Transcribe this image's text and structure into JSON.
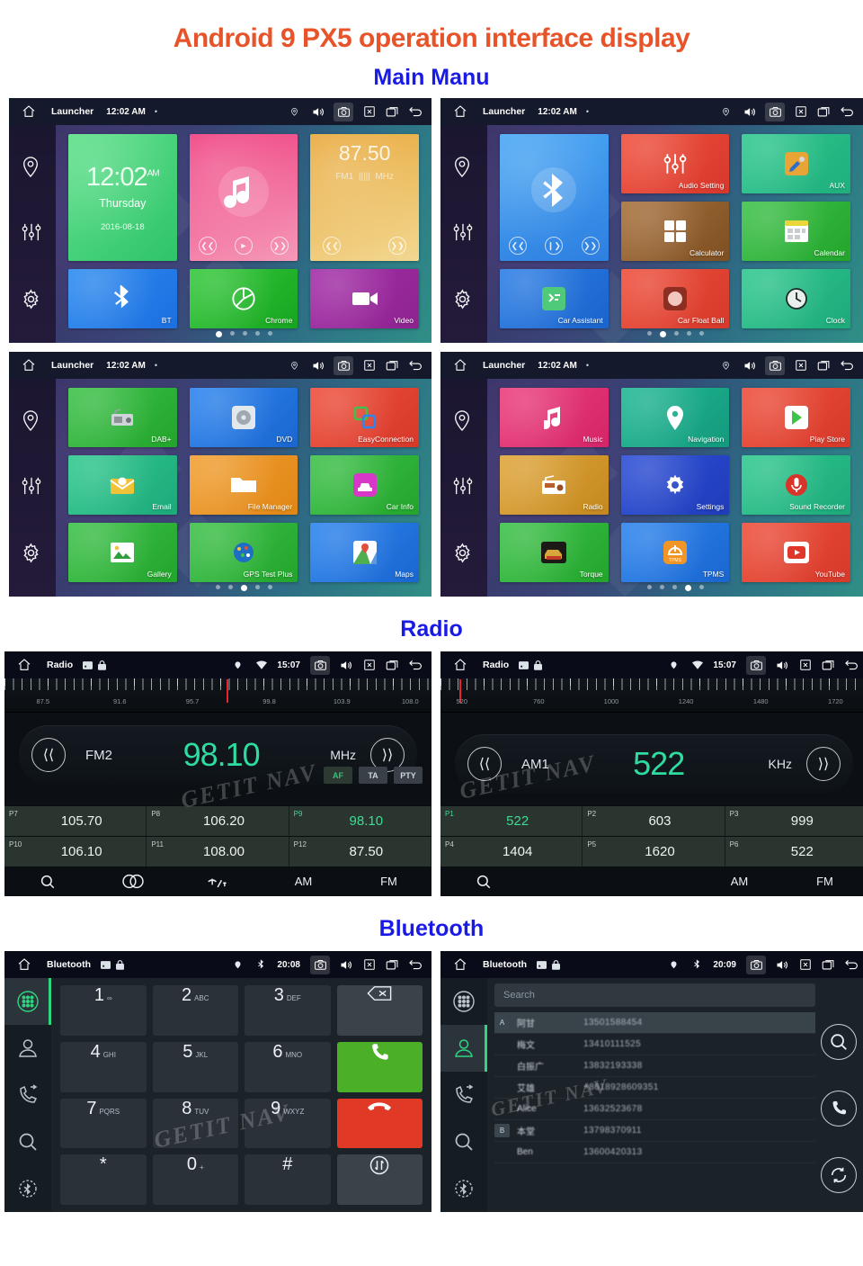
{
  "page": {
    "main_title_prefix": "Android",
    "main_title_number": "9",
    "main_title_suffix": "PX5 operation interface display",
    "section_main_menu": "Main Manu",
    "section_radio": "Radio",
    "section_bluetooth": "Bluetooth",
    "watermark": "GETIT NAV",
    "colors": {
      "title_orange": "#e8542a",
      "section_blue": "#1a1ae6",
      "radio_green": "#2fdca0",
      "accent_green": "#2fd67f",
      "needle_red": "#e8242c"
    }
  },
  "launcher_statusbar": {
    "home_icon": "home-icon",
    "title": "Launcher",
    "clock": "12:02 AM",
    "dot": "•",
    "icons": [
      "location-icon",
      "volume-icon",
      "camera-icon",
      "close-icon",
      "recents-icon",
      "back-icon"
    ]
  },
  "left_rail": {
    "items": [
      {
        "icon": "location-pin-icon",
        "name": "navigation"
      },
      {
        "icon": "equalizer-icon",
        "name": "audio-settings"
      },
      {
        "icon": "gear-icon",
        "name": "settings"
      }
    ]
  },
  "screens": [
    {
      "id": "launcher-page-1",
      "page_index": 0,
      "page_count": 5,
      "widgets": {
        "clock": {
          "time": "12:02",
          "ampm": "AM",
          "weekday": "Thursday",
          "date": "2016-08-18"
        },
        "music": {
          "icon": "music-note-icon",
          "controls": [
            "prev-icon",
            "play-icon",
            "next-icon"
          ]
        },
        "radio": {
          "frequency": "87.50",
          "band": "FM1",
          "unit": "MHz",
          "controls": [
            "prev-icon",
            "next-icon"
          ]
        }
      },
      "tiles": [
        {
          "label": "BT",
          "icon": "bluetooth-icon",
          "color_a": "#2e8cf0",
          "color_b": "#1c6fe0"
        },
        {
          "label": "Chrome",
          "icon": "chrome-icon",
          "color_a": "#35c93b",
          "color_b": "#17a520"
        },
        {
          "label": "Video",
          "icon": "video-camera-icon",
          "color_a": "#a42fa8",
          "color_b": "#8e2390"
        }
      ]
    },
    {
      "id": "launcher-page-2",
      "page_index": 1,
      "page_count": 5,
      "widgets": {
        "bluetooth": {
          "icon": "bluetooth-icon",
          "controls": [
            "prev-icon",
            "play-pause-icon",
            "next-icon"
          ]
        }
      },
      "tiles": [
        {
          "label": "Audio Setting",
          "icon": "equalizer-icon",
          "color_a": "#f0503c",
          "color_b": "#d8382c"
        },
        {
          "label": "AUX",
          "icon": "aux-plug-icon",
          "color_a": "#2fc98f",
          "color_b": "#1fae7c"
        },
        {
          "label": "Calculator",
          "icon": "calculator-icon",
          "color_a": "#a8713a",
          "color_b": "#7d4f23"
        },
        {
          "label": "Calendar",
          "icon": "calendar-icon",
          "color_a": "#3ec24a",
          "color_b": "#23a52c"
        },
        {
          "label": "Car Assistant",
          "icon": "car-assistant-icon",
          "color_a": "#2d7fe6",
          "color_b": "#1a64cc"
        },
        {
          "label": "Car Float Ball",
          "icon": "float-ball-icon",
          "color_a": "#ef4f3b",
          "color_b": "#d6392a"
        },
        {
          "label": "Clock",
          "icon": "clock-icon",
          "color_a": "#2fc98f",
          "color_b": "#1da97a"
        }
      ]
    },
    {
      "id": "launcher-page-3",
      "page_index": 2,
      "page_count": 5,
      "tiles": [
        {
          "label": "DAB+",
          "icon": "dab-radio-icon",
          "color_a": "#3ec24a",
          "color_b": "#23a52c"
        },
        {
          "label": "DVD",
          "icon": "dvd-disc-icon",
          "color_a": "#2d85ef",
          "color_b": "#1a66d0"
        },
        {
          "label": "EasyConnection",
          "icon": "easyconnection-icon",
          "color_a": "#ef4f3b",
          "color_b": "#d6392a"
        },
        {
          "label": "Email",
          "icon": "email-icon",
          "color_a": "#2fc98f",
          "color_b": "#1da97a"
        },
        {
          "label": "File Manager",
          "icon": "folder-icon",
          "color_a": "#f2a032",
          "color_b": "#e08616"
        },
        {
          "label": "Car Info",
          "icon": "car-info-icon",
          "color_a": "#3ec24a",
          "color_b": "#23a52c"
        },
        {
          "label": "Gallery",
          "icon": "gallery-icon",
          "color_a": "#3ec24a",
          "color_b": "#23a52c"
        },
        {
          "label": "GPS Test Plus",
          "icon": "gps-test-icon",
          "color_a": "#3ec24a",
          "color_b": "#23a52c"
        },
        {
          "label": "Maps",
          "icon": "maps-icon",
          "color_a": "#2d85ef",
          "color_b": "#1a66d0"
        }
      ]
    },
    {
      "id": "launcher-page-4",
      "page_index": 3,
      "page_count": 5,
      "tiles": [
        {
          "label": "Music",
          "icon": "music-note-icon",
          "color_a": "#ec3f7e",
          "color_b": "#d42568"
        },
        {
          "label": "Navigation",
          "icon": "location-pin-icon",
          "color_a": "#20b894",
          "color_b": "#139a7c"
        },
        {
          "label": "Play Store",
          "icon": "play-store-icon",
          "color_a": "#ef4f3b",
          "color_b": "#d6392a"
        },
        {
          "label": "Radio",
          "icon": "radio-icon",
          "color_a": "#e0a63a",
          "color_b": "#c4881f"
        },
        {
          "label": "Settings",
          "icon": "gear-icon",
          "color_a": "#2d4fd6",
          "color_b": "#1f3cba"
        },
        {
          "label": "Sound Recorder",
          "icon": "microphone-icon",
          "color_a": "#2fc98f",
          "color_b": "#1da97a"
        },
        {
          "label": "Torque",
          "icon": "torque-icon",
          "color_a": "#3ec24a",
          "color_b": "#23a52c"
        },
        {
          "label": "TPMS",
          "icon": "tpms-icon",
          "color_a": "#2d85ef",
          "color_b": "#1a66d0"
        },
        {
          "label": "YouTube",
          "icon": "youtube-icon",
          "color_a": "#ef4f3b",
          "color_b": "#d6392a"
        }
      ]
    }
  ],
  "radio": {
    "fm": {
      "statusbar": {
        "home_icon": "home-icon",
        "title": "Radio",
        "time": "15:07",
        "mini_icons": [
          "sd-card-icon",
          "lock-icon"
        ],
        "status_icons": [
          "location-icon",
          "wifi-icon"
        ],
        "right_icons": [
          "camera-icon",
          "volume-icon",
          "close-icon",
          "recents-icon",
          "back-icon"
        ]
      },
      "scale_labels": [
        "87.5",
        "91.6",
        "95.7",
        "99.8",
        "103.9",
        "108.0"
      ],
      "needle_position_pct": 52,
      "band": "FM2",
      "frequency": "98.10",
      "unit": "MHz",
      "prev_icon": "prev-icon",
      "next_icon": "next-icon",
      "rds": [
        "AF",
        "TA",
        "PTY"
      ],
      "rds_active": "AF",
      "presets": [
        {
          "slot": "P7",
          "value": "105.70",
          "active": false
        },
        {
          "slot": "P8",
          "value": "106.20",
          "active": false
        },
        {
          "slot": "P9",
          "value": "98.10",
          "active": true
        },
        {
          "slot": "P10",
          "value": "106.10",
          "active": false
        },
        {
          "slot": "P11",
          "value": "108.00",
          "active": false
        },
        {
          "slot": "P12",
          "value": "87.50",
          "active": false
        }
      ],
      "bottom_bar": [
        {
          "label": "",
          "icon": "search-icon"
        },
        {
          "label": "",
          "icon": "stereo-icon"
        },
        {
          "label": "",
          "icon": "antenna-icon"
        },
        {
          "label": "AM",
          "icon": ""
        },
        {
          "label": "FM",
          "icon": ""
        }
      ]
    },
    "am": {
      "statusbar": {
        "home_icon": "home-icon",
        "title": "Radio",
        "time": "15:07",
        "mini_icons": [
          "sd-card-icon",
          "lock-icon"
        ],
        "status_icons": [
          "location-icon",
          "wifi-icon"
        ],
        "right_icons": [
          "camera-icon",
          "volume-icon",
          "close-icon",
          "recents-icon",
          "back-icon"
        ]
      },
      "scale_labels": [
        "520",
        "760",
        "1000",
        "1240",
        "1480",
        "1720"
      ],
      "needle_position_pct": 4,
      "band": "AM1",
      "frequency": "522",
      "unit": "KHz",
      "prev_icon": "prev-icon",
      "next_icon": "next-icon",
      "presets": [
        {
          "slot": "P1",
          "value": "522",
          "active": true
        },
        {
          "slot": "P2",
          "value": "603",
          "active": false
        },
        {
          "slot": "P3",
          "value": "999",
          "active": false
        },
        {
          "slot": "P4",
          "value": "1404",
          "active": false
        },
        {
          "slot": "P5",
          "value": "1620",
          "active": false
        },
        {
          "slot": "P6",
          "value": "522",
          "active": false
        }
      ],
      "bottom_bar": [
        {
          "label": "",
          "icon": "search-icon"
        },
        {
          "label": "",
          "icon": ""
        },
        {
          "label": "",
          "icon": ""
        },
        {
          "label": "AM",
          "icon": ""
        },
        {
          "label": "FM",
          "icon": ""
        }
      ]
    }
  },
  "bluetooth": {
    "dialer": {
      "statusbar": {
        "home_icon": "home-icon",
        "title": "Bluetooth",
        "time": "20:08",
        "mini_icons": [
          "sd-card-icon",
          "lock-icon"
        ],
        "status_icons": [
          "location-icon",
          "bluetooth-icon"
        ],
        "right_icons": [
          "camera-icon",
          "volume-icon",
          "close-icon",
          "recents-icon",
          "back-icon"
        ]
      },
      "rail": [
        {
          "icon": "dialpad-icon",
          "selected": true
        },
        {
          "icon": "contacts-icon",
          "selected": false
        },
        {
          "icon": "call-log-icon",
          "selected": false
        },
        {
          "icon": "search-icon",
          "selected": false
        },
        {
          "icon": "bluetooth-settings-icon",
          "selected": false
        }
      ],
      "keys": [
        {
          "digit": "1",
          "sub": "∞"
        },
        {
          "digit": "2",
          "sub": "ABC"
        },
        {
          "digit": "3",
          "sub": "DEF"
        },
        {
          "digit": "",
          "sub": "",
          "icon": "backspace-icon",
          "kind": "fn"
        },
        {
          "digit": "4",
          "sub": "GHI"
        },
        {
          "digit": "5",
          "sub": "JKL"
        },
        {
          "digit": "6",
          "sub": "MNO"
        },
        {
          "digit": "",
          "sub": "",
          "icon": "call-icon",
          "kind": "call"
        },
        {
          "digit": "7",
          "sub": "PQRS"
        },
        {
          "digit": "8",
          "sub": "TUV"
        },
        {
          "digit": "9",
          "sub": "WXYZ"
        },
        {
          "digit": "",
          "sub": "",
          "icon": "end-call-icon",
          "kind": "end"
        },
        {
          "digit": "*",
          "sub": ""
        },
        {
          "digit": "0",
          "sub": "+"
        },
        {
          "digit": "#",
          "sub": ""
        },
        {
          "digit": "",
          "sub": "",
          "icon": "transfer-icon",
          "kind": "fn"
        }
      ]
    },
    "contacts": {
      "statusbar": {
        "home_icon": "home-icon",
        "title": "Bluetooth",
        "time": "20:09",
        "mini_icons": [
          "sd-card-icon",
          "lock-icon"
        ],
        "status_icons": [
          "location-icon",
          "bluetooth-icon"
        ],
        "right_icons": [
          "camera-icon",
          "volume-icon",
          "close-icon",
          "recents-icon",
          "back-icon"
        ]
      },
      "rail": [
        {
          "icon": "dialpad-icon",
          "selected": false
        },
        {
          "icon": "contacts-icon",
          "selected": true
        },
        {
          "icon": "call-log-icon",
          "selected": false
        },
        {
          "icon": "search-icon",
          "selected": false
        },
        {
          "icon": "bluetooth-settings-icon",
          "selected": false
        }
      ],
      "search_placeholder": "Search",
      "list": [
        {
          "group": "A",
          "name": "阿甘",
          "phone": "13501588454",
          "selected": true
        },
        {
          "group": "",
          "name": "梅文",
          "phone": "13410111525",
          "selected": false
        },
        {
          "group": "",
          "name": "白振广",
          "phone": "13832193338",
          "selected": false
        },
        {
          "group": "",
          "name": "艾雄",
          "phone": "+8618928609351",
          "selected": false
        },
        {
          "group": "",
          "name": "Alice",
          "phone": "13632523678",
          "selected": false
        },
        {
          "group": "B",
          "name": "本堂",
          "phone": "13798370911",
          "selected": false
        },
        {
          "group": "",
          "name": "Ben",
          "phone": "13600420313",
          "selected": false
        }
      ],
      "side_buttons": [
        "search-icon",
        "call-icon",
        "sync-icon"
      ]
    }
  }
}
